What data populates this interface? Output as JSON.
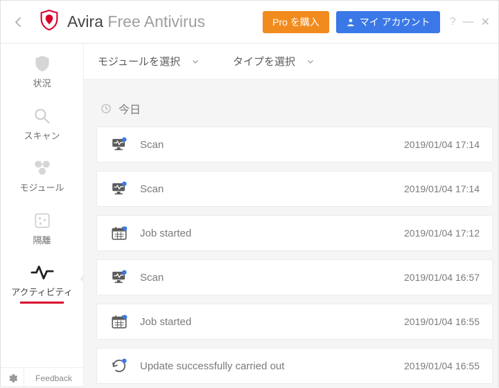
{
  "header": {
    "brand_bold": "Avira",
    "brand_light": " Free Antivirus",
    "buy_pro": "Pro を購入",
    "my_account": "マイ アカウント"
  },
  "sidebar": {
    "items": [
      {
        "label": "状況"
      },
      {
        "label": "スキャン"
      },
      {
        "label": "モジュール"
      },
      {
        "label": "隔離"
      },
      {
        "label": "アクティビティ"
      }
    ],
    "feedback": "Feedback"
  },
  "filters": {
    "module": "モジュールを選択",
    "type": "タイプを選択"
  },
  "section_today": "今日",
  "events": [
    {
      "icon": "scan",
      "label": "Scan",
      "time": "2019/01/04 17:14"
    },
    {
      "icon": "scan",
      "label": "Scan",
      "time": "2019/01/04 17:14"
    },
    {
      "icon": "job",
      "label": "Job started",
      "time": "2019/01/04 17:12"
    },
    {
      "icon": "scan",
      "label": "Scan",
      "time": "2019/01/04 16:57"
    },
    {
      "icon": "job",
      "label": "Job started",
      "time": "2019/01/04 16:55"
    },
    {
      "icon": "update",
      "label": "Update successfully carried out",
      "time": "2019/01/04 16:55"
    }
  ]
}
